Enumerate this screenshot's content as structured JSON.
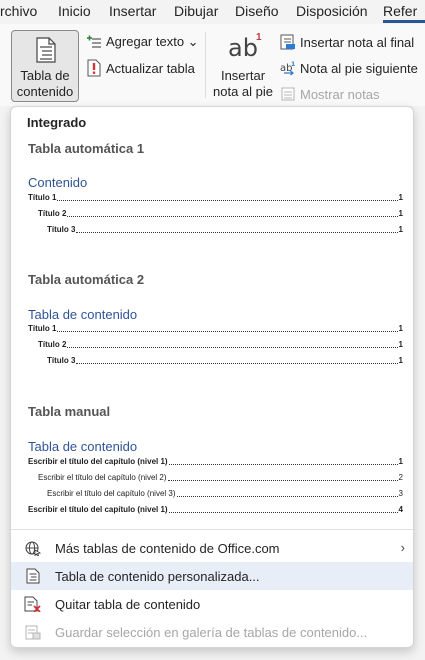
{
  "tabs": [
    {
      "label": "rchivo",
      "active": false
    },
    {
      "label": "Inicio",
      "active": false
    },
    {
      "label": "Insertar",
      "active": false
    },
    {
      "label": "Dibujar",
      "active": false
    },
    {
      "label": "Diseño",
      "active": false
    },
    {
      "label": "Disposición",
      "active": false
    },
    {
      "label": "Refer",
      "active": true
    }
  ],
  "ribbon": {
    "toc_button": {
      "line1": "Tabla de",
      "line2": "contenido ⌄",
      "icon": "table-of-contents-icon"
    },
    "add_text": {
      "label": "Agregar texto ⌄",
      "icon": "add-text-icon"
    },
    "update_table": {
      "label": "Actualizar tabla",
      "icon": "update-table-icon"
    },
    "insert_footnote": {
      "glyph": "ab",
      "superscript": "1",
      "line1": "Insertar",
      "line2": "nota al pie"
    },
    "insert_endnote": {
      "label": "Insertar nota al final",
      "icon": "insert-endnote-icon"
    },
    "next_footnote": {
      "label": "Nota al pie siguiente",
      "icon": "next-footnote-icon"
    },
    "show_notes": {
      "label": "Mostrar notas",
      "icon": "show-notes-icon",
      "disabled": true
    }
  },
  "panel": {
    "header": "Integrado",
    "sections": [
      {
        "title": "Tabla automática 1",
        "heading": "Contenido",
        "lines": [
          {
            "text": "Título 1",
            "page": "1",
            "level": 1
          },
          {
            "text": "Título 2",
            "page": "1",
            "level": 2
          },
          {
            "text": "Título 3",
            "page": "1",
            "level": 3
          }
        ]
      },
      {
        "title": "Tabla automática 2",
        "heading": "Tabla de contenido",
        "lines": [
          {
            "text": "Título 1",
            "page": "1",
            "level": 1
          },
          {
            "text": "Título 2",
            "page": "1",
            "level": 2
          },
          {
            "text": "Título 3",
            "page": "1",
            "level": 3
          }
        ]
      },
      {
        "title": "Tabla manual",
        "heading": "Tabla de contenido",
        "lines": [
          {
            "text": "Escribir el título del capítulo (nivel 1)",
            "page": "1",
            "level": 1
          },
          {
            "text": "Escribir el título del capítulo (nivel 2)",
            "page": "2",
            "level": 2
          },
          {
            "text": "Escribir el título del capítulo (nivel 3)",
            "page": "3",
            "level": 3
          },
          {
            "text": "Escribir el título del capítulo (nivel 1)",
            "page": "4",
            "level": 1
          }
        ]
      }
    ],
    "menu_items": [
      {
        "label": "Más tablas de contenido de Office.com",
        "icon": "globe-icon",
        "has_submenu": true,
        "disabled": false,
        "hover": false
      },
      {
        "label": "Tabla de contenido personalizada...",
        "icon": "custom-toc-icon",
        "has_submenu": false,
        "disabled": false,
        "hover": true
      },
      {
        "label": "Quitar tabla de contenido",
        "icon": "remove-toc-icon",
        "has_submenu": false,
        "disabled": false,
        "hover": false
      },
      {
        "label": "Guardar selección en galería de tablas de contenido...",
        "icon": "save-gallery-icon",
        "has_submenu": false,
        "disabled": true,
        "hover": false
      }
    ]
  },
  "colors": {
    "accent": "#2b579a",
    "toc_heading": "#2f5496",
    "hover": "#e8eef7",
    "disabled": "#a6a6a6"
  }
}
